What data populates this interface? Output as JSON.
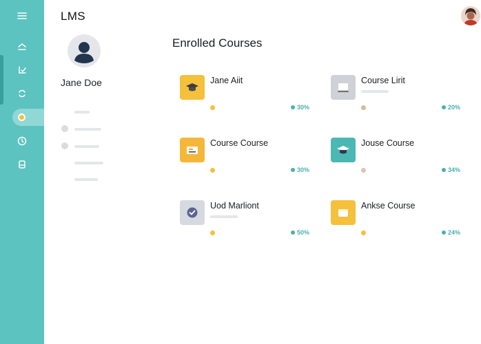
{
  "header": {
    "app_title": "LMS"
  },
  "profile": {
    "name": "Jane Doe"
  },
  "main": {
    "section_title": "Enrolled Courses",
    "courses": [
      {
        "title": "Jane Aiit",
        "progress": "30%",
        "icon": "graduation-cap-icon",
        "color": "#f5c03b",
        "dot_color": "#f5c03b"
      },
      {
        "title": "Course Lirit",
        "progress": "20%",
        "icon": "laptop-icon",
        "color": "#cfd1d6",
        "dot_color": "#d9b99b"
      },
      {
        "title": "Course Course",
        "progress": "30%",
        "icon": "certificate-icon",
        "color": "#f5b73a",
        "dot_color": "#f5c03b"
      },
      {
        "title": "Jouse Course",
        "progress": "34%",
        "icon": "graduation-cap-icon",
        "color": "#4cb8b3",
        "dot_color": "#d7c6bb"
      },
      {
        "title": "Uod Marliont",
        "progress": "50%",
        "icon": "check-badge-icon",
        "color": "#d7d9e0",
        "dot_color": "#f5c03b"
      },
      {
        "title": "Ankse Course",
        "progress": "24%",
        "icon": "folder-icon",
        "color": "#f5c03b",
        "dot_color": "#f5c03b"
      }
    ]
  },
  "colors": {
    "sidebar": "#5cc3c0",
    "accent_teal": "#4cb0ac",
    "accent_yellow": "#f5c03b"
  }
}
